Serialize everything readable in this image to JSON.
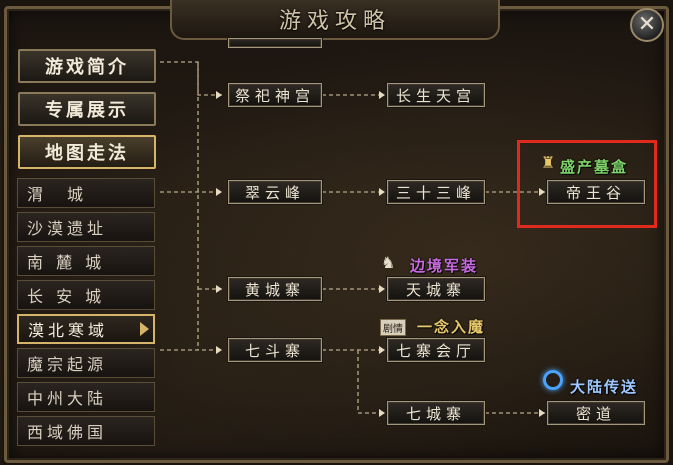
{
  "window": {
    "title": "游戏攻略",
    "close_icon": "close-x-icon"
  },
  "menu": {
    "tabs": [
      "游戏简介",
      "专属展示",
      "地图走法"
    ],
    "active_tab": "地图走法",
    "items": [
      "渭　城",
      "沙漠遗址",
      "南 麓 城",
      "长 安 城",
      "漠北寒域",
      "魔宗起源",
      "中州大陆",
      "西域佛国"
    ],
    "selected_item": "漠北寒域"
  },
  "map": {
    "top_stub": "",
    "nodes": {
      "jisi": "祭祀神宫",
      "changsheng": "长生天宫",
      "cuiyun": "翠云峰",
      "sanshisan": "三十三峰",
      "diwang": "帝王谷",
      "huangcheng": "黄城寨",
      "tiancheng": "天城寨",
      "qidou": "七斗寨",
      "qizhai": "七寨会厅",
      "qicheng": "七城寨",
      "midao": "密道"
    },
    "labels": {
      "tomb": "盛产墓盒",
      "border": "边境军装",
      "demon_prefix": "剧情",
      "demon": "一念入魔",
      "continent": "大陆传送"
    },
    "colors": {
      "tomb": "#7fd46a",
      "border": "#c86ae0",
      "demon": "#e7c86a",
      "continent": "#9ec8ff",
      "highlight": "#e02a1e"
    }
  }
}
